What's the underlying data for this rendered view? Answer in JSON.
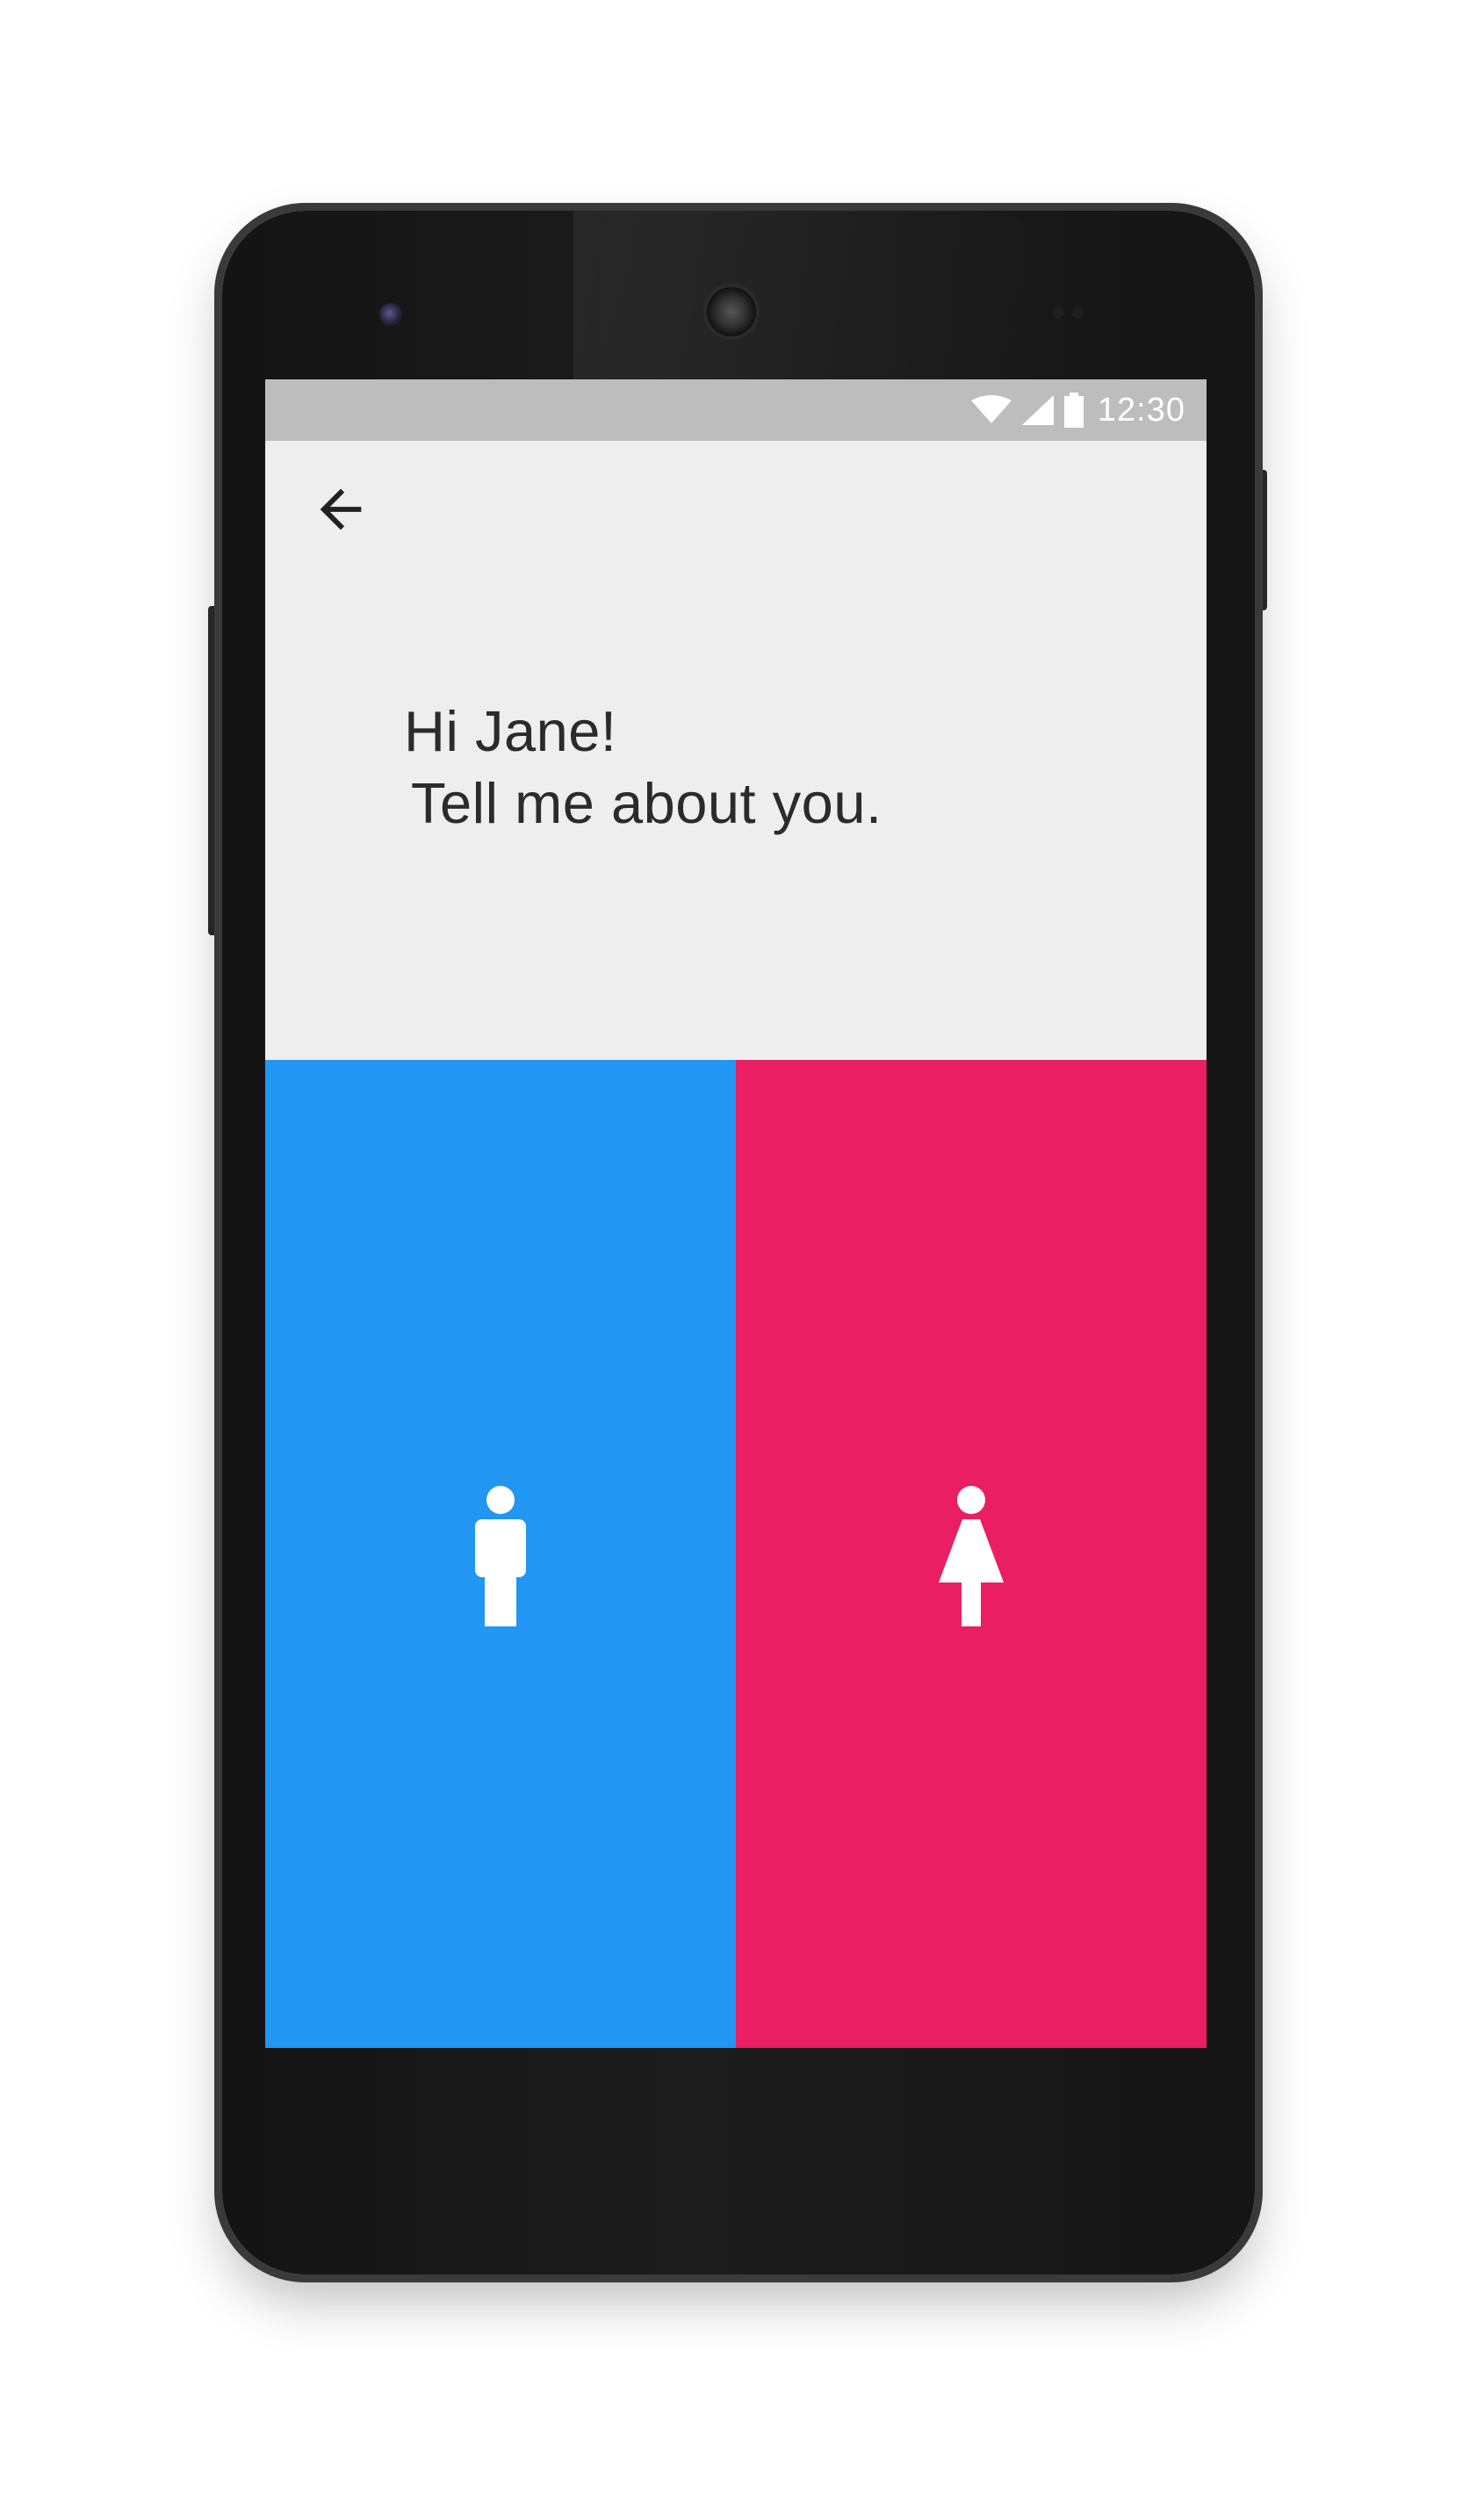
{
  "status_bar": {
    "time": "12:30",
    "icons": [
      "wifi-icon",
      "cell-signal-icon",
      "battery-icon"
    ]
  },
  "nav": {
    "back_icon": "arrow-back-icon"
  },
  "greeting": {
    "line1": "Hi Jane!",
    "line2": "Tell me about you."
  },
  "choices": {
    "male": {
      "icon": "male-figure-icon",
      "color": "#2196F3"
    },
    "female": {
      "icon": "female-figure-icon",
      "color": "#E91E63"
    }
  },
  "colors": {
    "screen_background": "#EEEEEE",
    "status_bar": "#BDBDBD",
    "text": "#2B2B2B"
  }
}
